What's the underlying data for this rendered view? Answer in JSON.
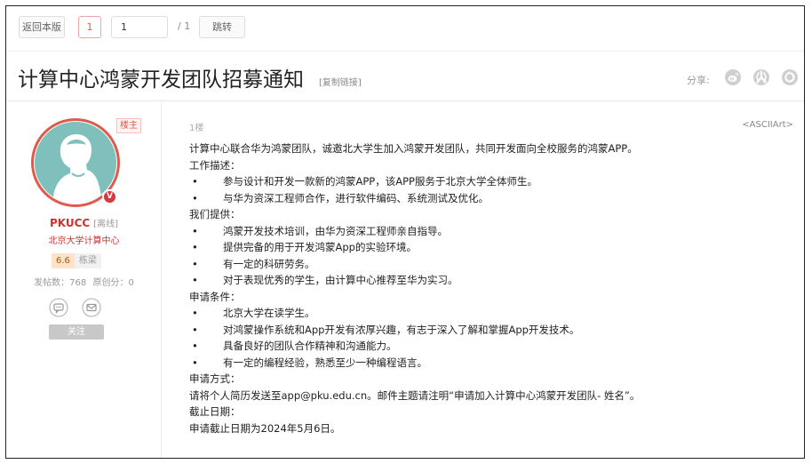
{
  "nav": {
    "back_label": "返回本版",
    "current_page": "1",
    "page_input_value": "1",
    "page_total": "/ 1",
    "jump_label": "跳转"
  },
  "header": {
    "title": "计算中心鸿蒙开发团队招募通知",
    "copy_link_label": "[复制链接]",
    "share_label": "分享:"
  },
  "author": {
    "role_badge": "楼主",
    "vip_badge": "V",
    "name": "PKUCC",
    "status": "[离线]",
    "org": "北京大学计算中心",
    "level_score": "6.6",
    "level_name": "栋梁",
    "post_count": "发帖数：768",
    "original_score": "原创分：0",
    "follow_label": "关注"
  },
  "post": {
    "floor": "1楼",
    "ascii_art_label": "<ASCIIArt>",
    "lines": {
      "l0": "计算中心联合华为鸿蒙团队，诚邀北大学生加入鸿蒙开发团队，共同开发面向全校服务的鸿蒙APP。",
      "l1": "工作描述：",
      "l2": "参与设计和开发一款新的鸿蒙APP，该APP服务于北京大学全体师生。",
      "l3": "与华为资深工程师合作，进行软件编码、系统测试及优化。",
      "l4": "我们提供：",
      "l5": "鸿蒙开发技术培训，由华为资深工程师亲自指导。",
      "l6": "提供完备的用于开发鸿蒙App的实验环境。",
      "l7": "有一定的科研劳务。",
      "l8": "对于表现优秀的学生，由计算中心推荐至华为实习。",
      "l9": "申请条件：",
      "l10": "北京大学在读学生。",
      "l11": "对鸿蒙操作系统和App开发有浓厚兴趣，有志于深入了解和掌握App开发技术。",
      "l12": "具备良好的团队合作精神和沟通能力。",
      "l13": "有一定的编程经验，熟悉至少一种编程语言。",
      "l14": "申请方式：",
      "l15": "请将个人简历发送至app@pku.edu.cn。邮件主题请注明“申请加入计算中心鸿蒙开发团队- 姓名”。",
      "l16": "截止日期：",
      "l17": "申请截止日期为2024年5月6日。"
    },
    "bullet": "•"
  },
  "icons": {
    "share_1": "weibo-icon",
    "share_2": "renren-icon",
    "share_3": "wechat-moments-icon",
    "message": "message-icon",
    "mail": "mail-icon"
  },
  "colors": {
    "accent_red": "#d0312d",
    "avatar_teal": "#7fc0bc",
    "avatar_ring": "#e05a4c"
  }
}
